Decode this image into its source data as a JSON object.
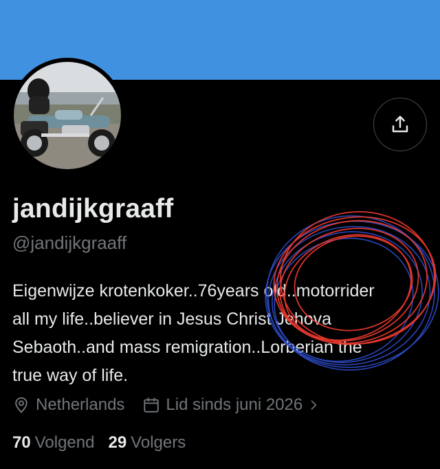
{
  "profile": {
    "display_name": "jandijkgraaff",
    "handle": "@jandijkgraaff",
    "bio": "Eigenwijze krotenkoker..76years old..motorrider\nall my life..believer in Jesus Christ Jehova\nSebaoth..and mass remigration..Lorberian the\ntrue way of life.",
    "location": "Netherlands",
    "joined": "Lid sinds juni 2026",
    "following_count": "70",
    "following_label": "Volgend",
    "followers_count": "29",
    "followers_label": "Volgers"
  },
  "icons": {
    "share": "share-icon",
    "location": "location-pin-icon",
    "calendar": "calendar-icon",
    "chevron": "chevron-right-icon"
  },
  "colors": {
    "banner": "#4191e1",
    "background": "#000000",
    "text_primary": "#e7e9ea",
    "text_secondary": "#71767b",
    "scribble_red": "#e8392f",
    "scribble_blue": "#2f4fd0"
  }
}
